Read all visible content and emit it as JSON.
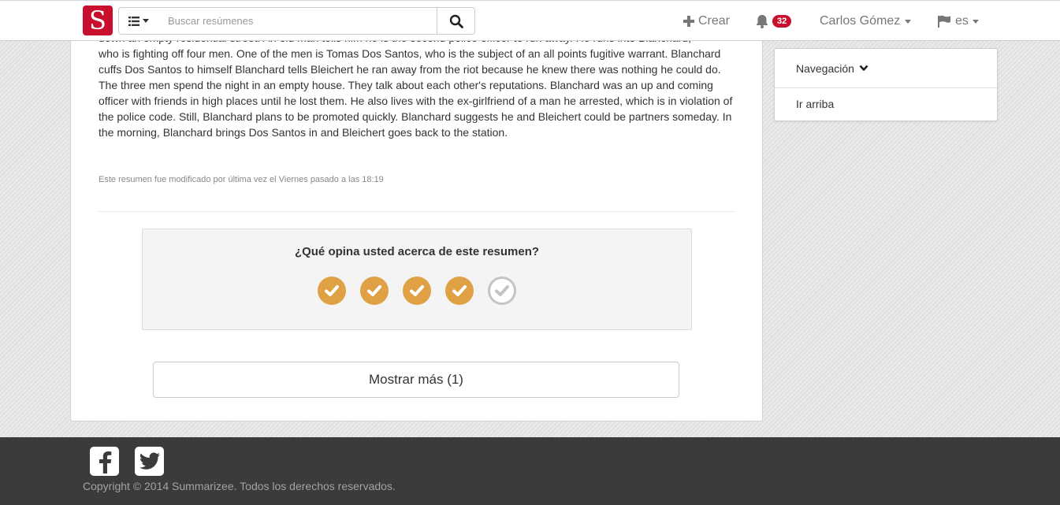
{
  "navbar": {
    "logo_letter": "S",
    "search_placeholder": "Buscar resúmenes",
    "create_label": "Crear",
    "notification_count": "32",
    "user_name": "Carlos Gómez",
    "language": "es"
  },
  "summary": {
    "paragraph_partial_line": "down an empty residential street. An old man tells him he is the second police officer to run away. He runs into Blanchard,",
    "paragraph": "who is fighting off four men. One of the men is Tomas Dos Santos, who is the subject of an all points fugitive warrant. Blanchard cuffs Dos Santos to himself Blanchard tells Bleichert he ran away from the riot because he knew there was nothing he could do. The three men spend the night in an empty house. They talk about each other's reputations. Blanchard was an up and coming officer with friends in high places until he lost them. He also lives with the ex-girlfriend of a man he arrested, which is in violation of the police code. Still, Blanchard plans to be promoted quickly. Blanchard suggests he and Bleichert could be partners someday. In the morning, Blanchard brings Dos Santos in and Bleichert goes back to the station.",
    "modified_note": "Este resumen fue modificado por última vez el Viernes pasado a las 18:19"
  },
  "rating": {
    "question": "¿Qué opina usted acerca de este resumen?",
    "value": 4,
    "max": 5
  },
  "show_more_label": "Mostrar más (1)",
  "sidebar": {
    "heading": "Navegación",
    "link": "Ir arriba"
  },
  "footer": {
    "copyright": "Copyright © 2014 Summarizee. Todos los derechos reservados."
  },
  "colors": {
    "brand": "#c8102e",
    "rating_active": "#e0a044",
    "rating_inactive": "#c4c4c4",
    "footer_bg": "#3b3b3b"
  }
}
